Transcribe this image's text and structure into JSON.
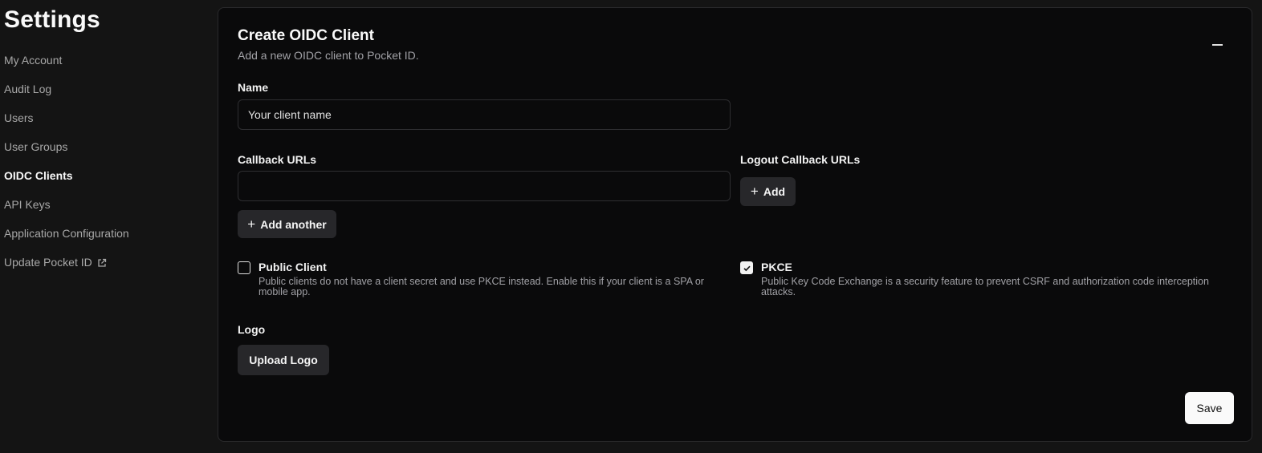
{
  "sidebar": {
    "title": "Settings",
    "items": [
      {
        "label": "My Account"
      },
      {
        "label": "Audit Log"
      },
      {
        "label": "Users"
      },
      {
        "label": "User Groups"
      },
      {
        "label": "OIDC Clients",
        "active": true
      },
      {
        "label": "API Keys"
      },
      {
        "label": "Application Configuration"
      },
      {
        "label": "Update Pocket ID",
        "icon": "external-link-icon"
      }
    ]
  },
  "form": {
    "title": "Create OIDC Client",
    "subtitle": "Add a new OIDC client to Pocket ID.",
    "name_label": "Name",
    "name_placeholder": "Your client name",
    "name_value": "",
    "callback_label": "Callback URLs",
    "callback_value": "",
    "add_another_label": "Add another",
    "logout_label": "Logout Callback URLs",
    "logout_add_label": "Add",
    "public_client_title": "Public Client",
    "public_client_desc": "Public clients do not have a client secret and use PKCE instead. Enable this if your client is a SPA or mobile app.",
    "public_client_checked": false,
    "pkce_title": "PKCE",
    "pkce_desc": "Public Key Code Exchange is a security feature to prevent CSRF and authorization code interception attacks.",
    "pkce_checked": true,
    "logo_label": "Logo",
    "upload_logo_label": "Upload Logo",
    "save_label": "Save"
  },
  "colors": {
    "background": "#141414",
    "card": "#0a0a0b",
    "button_secondary": "#27272a",
    "button_primary": "#fafafa"
  }
}
